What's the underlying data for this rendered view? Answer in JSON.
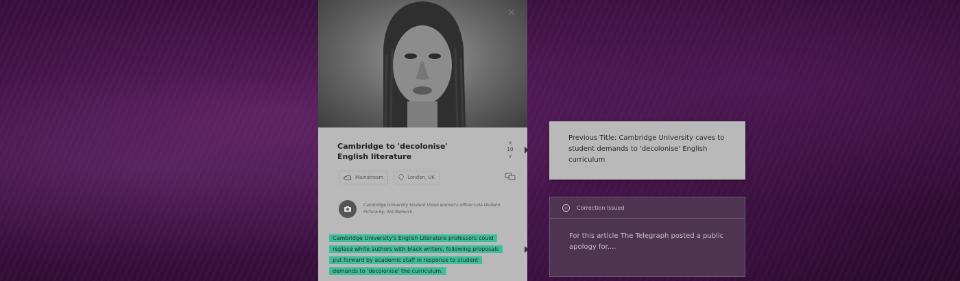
{
  "article": {
    "title": "Cambridge to 'decolonise' English literature",
    "vote_count": "10",
    "tags": [
      {
        "label": "Mainstream",
        "icon": "cloud-icon"
      },
      {
        "label": "London, UK",
        "icon": "location-pin-icon"
      }
    ],
    "caption": "Cambridge University Student Union women's officer Lola Olufemi",
    "photo_credit": "Picture by: Ant Renwick",
    "highlighted_text": "Cambridge University's English Literature professors could replace white authors with black writers, following proposals put forward by academic staff in response to student demands to 'decolonise' the curriculum."
  },
  "previous_title": {
    "text": "Previous Title: Cambridge University caves to student demands to 'decolonise' English curriculum"
  },
  "correction": {
    "heading": "Correction Issued",
    "body": "For this article The Telegraph posted a public apology for...."
  },
  "colors": {
    "background": "#3c1140",
    "card": "#b9b9b9",
    "highlight": "#3cbf9a",
    "correction_panel": "#4e3450"
  }
}
